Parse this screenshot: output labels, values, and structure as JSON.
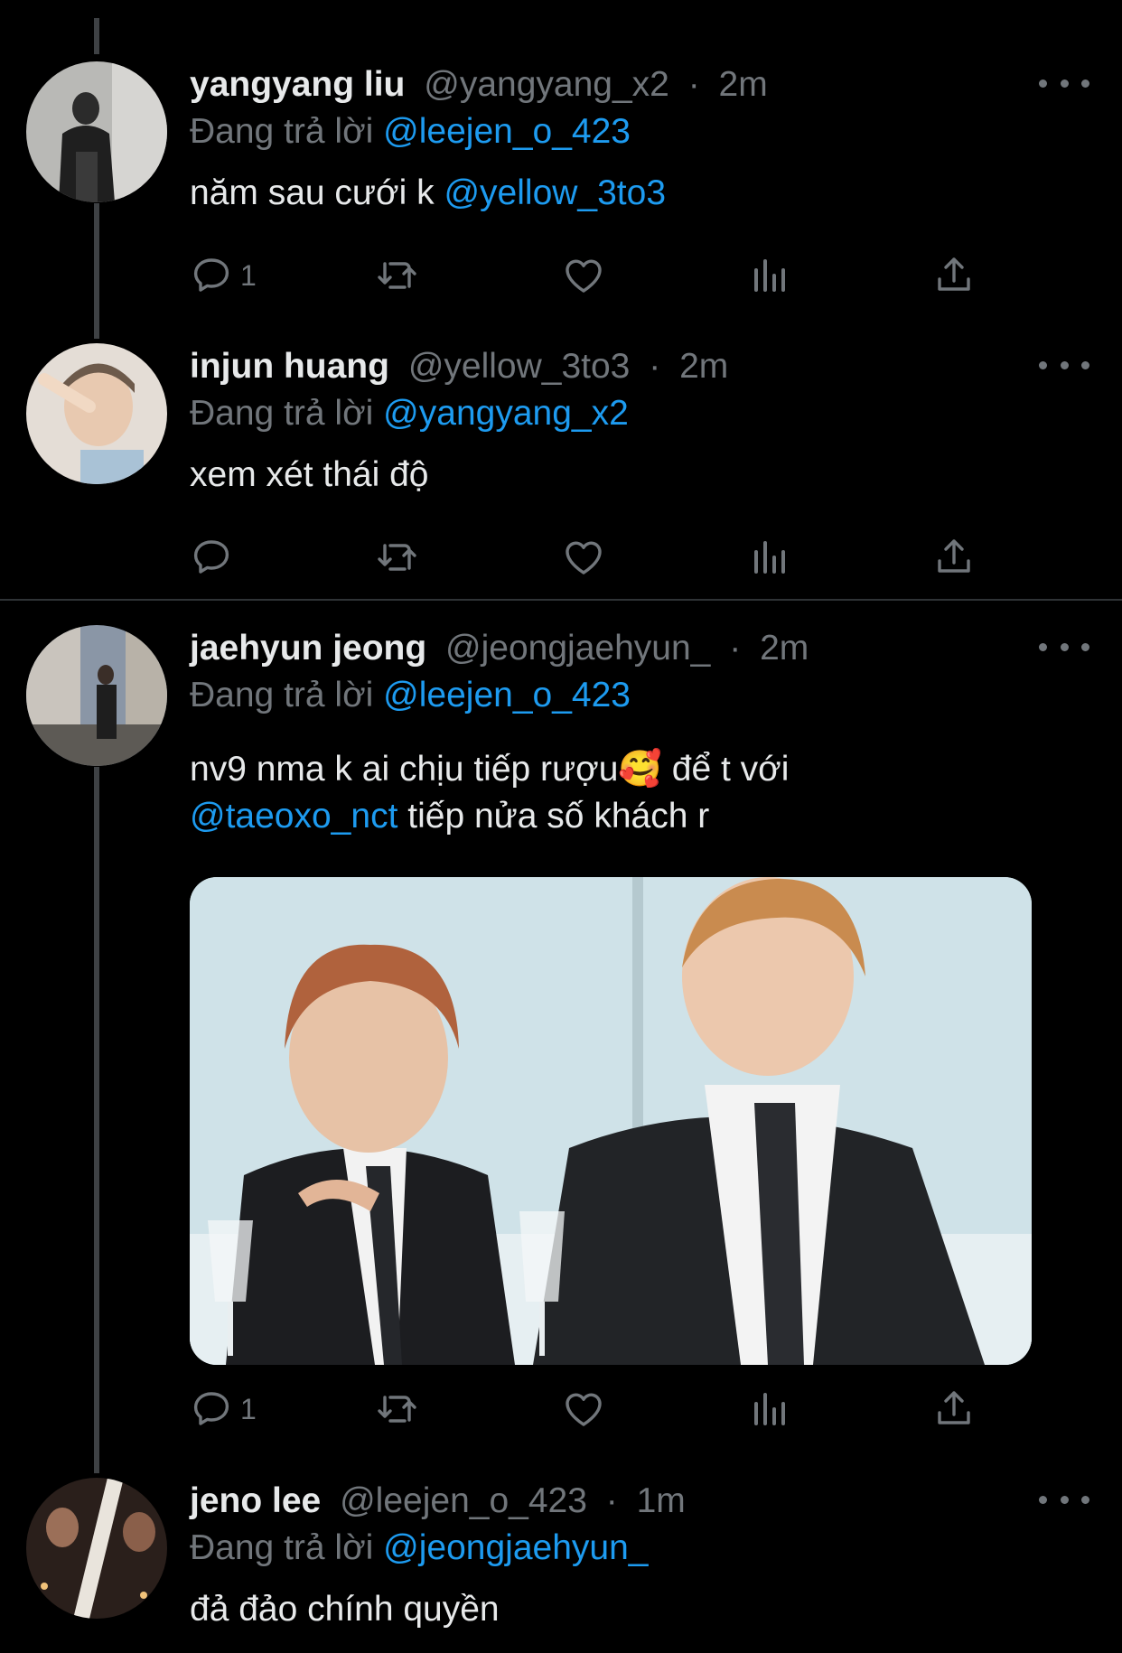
{
  "tweets": [
    {
      "name": "yangyang liu",
      "handle": "@yangyang_x2",
      "sep": "·",
      "time": "2m",
      "replying_prefix": "Đang trả lời",
      "replying_to": "@leejen_o_423",
      "text": "năm sau cưới k",
      "text_mention": "@yellow_3to3",
      "reply_count": "1"
    },
    {
      "name": "injun huang",
      "handle": "@yellow_3to3",
      "sep": "·",
      "time": "2m",
      "replying_prefix": "Đang trả lời",
      "replying_to": "@yangyang_x2",
      "text": "xem xét thái độ",
      "reply_count": ""
    },
    {
      "name": "jaehyun jeong",
      "handle": "@jeongjaehyun_",
      "sep": "·",
      "time": "2m",
      "replying_prefix": "Đang trả lời",
      "replying_to": "@leejen_o_423",
      "text_line1": "nv9 nma k ai chịu tiếp rượu🥰 để t với",
      "text_mention": "@taeoxo_nct",
      "text_line2_rest": "tiếp nửa số khách r",
      "reply_count": "1"
    },
    {
      "name": "jeno lee",
      "handle": "@leejen_o_423",
      "sep": "·",
      "time": "1m",
      "replying_prefix": "Đang trả lời",
      "replying_to": "@jeongjaehyun_",
      "text": "đả đảo chính quyền"
    }
  ],
  "icons": {
    "reply": "reply-icon",
    "retweet": "retweet-icon",
    "like": "heart-icon",
    "views": "views-icon",
    "share": "share-icon",
    "more": "more-icon"
  },
  "colors": {
    "background": "#000000",
    "mention": "#1d9bf0",
    "secondary": "#71767b",
    "primary_text": "#e7e9ea"
  }
}
